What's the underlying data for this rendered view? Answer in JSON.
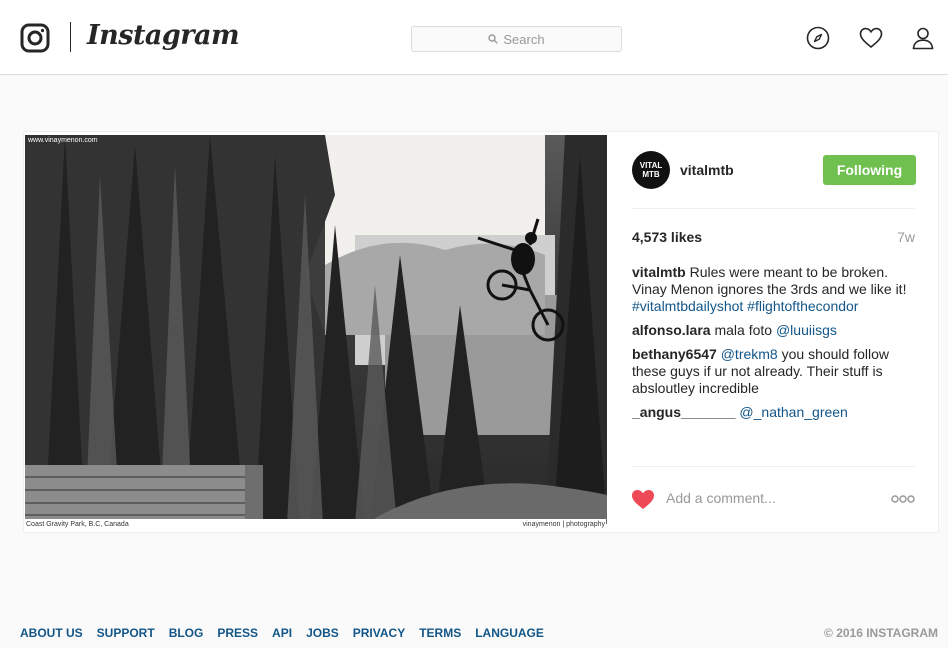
{
  "header": {
    "wordmark": "Instagram",
    "search_placeholder": "Search",
    "icons": [
      "instagram-camera-icon",
      "search-icon",
      "compass-icon",
      "heart-icon",
      "user-icon"
    ]
  },
  "post": {
    "photo": {
      "credit_top": "www.vinaymenon.com",
      "caption_left": "Coast Gravity Park, B.C, Canada",
      "caption_right": "vinaymenon | photography"
    },
    "author": {
      "avatar_text": "VITAL MTB",
      "username": "vitalmtb",
      "follow_label": "Following"
    },
    "likes": "4,573 likes",
    "age": "7w",
    "comments": [
      {
        "user": "vitalmtb",
        "text": " Rules were meant to be broken. Vinay Menon ignores the 3rds and we like it! ",
        "link": "#vitalmtbdailyshot #flightofthecondor"
      },
      {
        "user": "alfonso.lara",
        "text": " mala foto ",
        "link": "@luuiisgs"
      },
      {
        "user": "bethany6547",
        "text_link": " @trekm8",
        "text": " you should follow these guys if ur not already. Their stuff is absloutley incredible"
      },
      {
        "user": "_angus_______",
        "text": " ",
        "link": "@_nathan_green"
      }
    ],
    "add_comment_placeholder": "Add a comment...",
    "colors": {
      "follow": "#70c050",
      "heart": "#ed4956",
      "link": "#125688"
    }
  },
  "footer": {
    "links": [
      "ABOUT US",
      "SUPPORT",
      "BLOG",
      "PRESS",
      "API",
      "JOBS",
      "PRIVACY",
      "TERMS",
      "LANGUAGE"
    ],
    "copyright": "© 2016 INSTAGRAM"
  }
}
